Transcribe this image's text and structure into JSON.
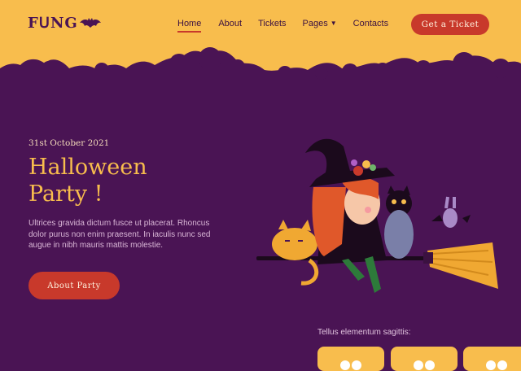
{
  "brand": {
    "logo_text": "FꓴNG"
  },
  "nav": {
    "items": [
      {
        "label": "Home"
      },
      {
        "label": "About"
      },
      {
        "label": "Tickets"
      },
      {
        "label": "Pages"
      },
      {
        "label": "Contacts"
      }
    ],
    "active": "Home",
    "cta_label": "Get a Ticket"
  },
  "hero": {
    "date": "31st October 2021",
    "title_line1": "Halloween",
    "title_line2": "Party !",
    "description": "Ultrices gravida dictum fusce ut placerat. Rhoncus dolor purus non enim praesent. In iaculis nunc sed augue in nibh mauris mattis molestie.",
    "button_label": "About Party"
  },
  "countdown": {
    "label": "Tellus elementum sagittis:"
  },
  "colors": {
    "background": "#4a1454",
    "accent": "#f8bd4d",
    "button": "#c8392b"
  },
  "icons": [
    "bat-icon",
    "chevron-down-icon"
  ]
}
